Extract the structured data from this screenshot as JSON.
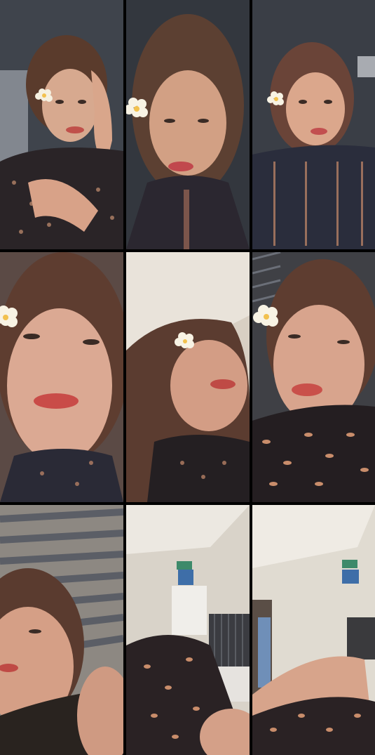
{
  "grid": {
    "rows": 3,
    "cols": 3,
    "divider_color": "#000000"
  },
  "tiles": [
    {
      "scene": "selfie-hand-on-head",
      "flower": true,
      "bg": "#4a4f57"
    },
    {
      "scene": "selfie-close-center",
      "flower": true,
      "bg": "#3b3f46"
    },
    {
      "scene": "selfie-head-tilted",
      "flower": true,
      "bg": "#3d424a"
    },
    {
      "scene": "selfie-very-close",
      "flower": true,
      "bg": "#6b5a52"
    },
    {
      "scene": "selfie-blurred-motion",
      "flower": true,
      "bg": "#d9cfc2"
    },
    {
      "scene": "selfie-pouting-close",
      "flower": true,
      "bg": "#4b4a4c"
    },
    {
      "scene": "selfie-low-angle-ceiling",
      "flower": false,
      "bg": "#8a8580"
    },
    {
      "scene": "room-view-shelf-arm",
      "flower": false,
      "bg": "#dcd6cc"
    },
    {
      "scene": "room-view-door-arm",
      "flower": false,
      "bg": "#e2ddd3"
    }
  ]
}
